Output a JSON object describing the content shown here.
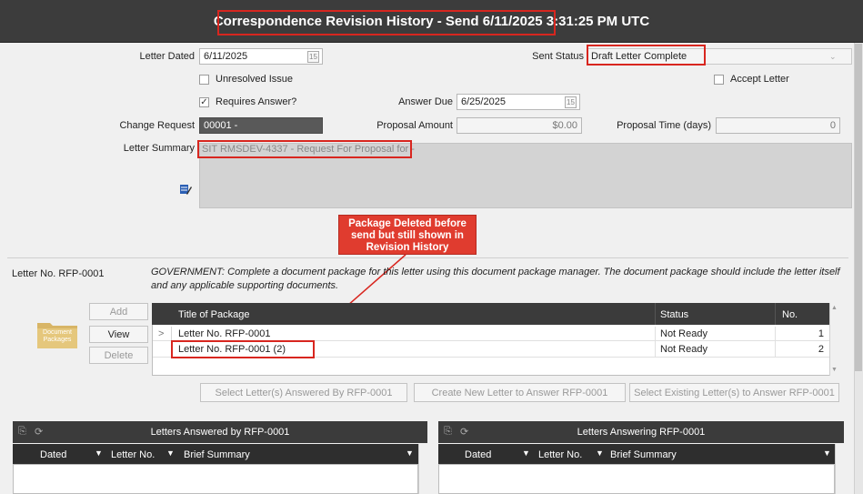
{
  "window": {
    "title": "Correspondence Revision History - Send 6/11/2025 3:31:25 PM UTC"
  },
  "form": {
    "letter_dated_label": "Letter Dated",
    "letter_dated_value": "6/11/2025",
    "sent_status_label": "Sent Status",
    "sent_status_value": "Draft Letter Complete",
    "unresolved_issue_label": "Unresolved Issue",
    "accept_letter_label": "Accept Letter",
    "requires_answer_label": "Requires Answer?",
    "requires_answer_checked": "✓",
    "answer_due_label": "Answer Due",
    "answer_due_value": "6/25/2025",
    "change_request_label": "Change Request",
    "change_request_value": "00001 -",
    "proposal_amount_label": "Proposal Amount",
    "proposal_amount_value": "$0.00",
    "proposal_time_label": "Proposal Time (days)",
    "proposal_time_value": "0",
    "letter_summary_label": "Letter Summary",
    "letter_summary_value": "SIT RMSDEV-4337 - Request For Proposal for -",
    "calendar_glyph": "15"
  },
  "annotation": {
    "callout_text": "Package Deleted before send but still shown in Revision History"
  },
  "packages": {
    "letter_no_label": "Letter No. RFP-0001",
    "instruction": "GOVERNMENT: Complete a document package for this letter using this document package manager. The document package should include the letter itself and any applicable supporting documents.",
    "icon_label": "Document Packages",
    "add_label": "Add",
    "view_label": "View",
    "delete_label": "Delete",
    "columns": [
      "Title of Package",
      "Status",
      "No."
    ],
    "rows": [
      {
        "indicator": ">",
        "title": "Letter No. RFP-0001",
        "status": "Not Ready",
        "no": "1"
      },
      {
        "indicator": "",
        "title": "Letter No. RFP-0001 (2)",
        "status": "Not Ready",
        "no": "2"
      }
    ],
    "select_answered_label": "Select Letter(s) Answered By RFP-0001",
    "create_new_label": "Create New Letter to Answer RFP-0001",
    "select_existing_label": "Select Existing Letter(s) to Answer RFP-0001"
  },
  "answered_by": {
    "title": "Letters Answered by RFP-0001",
    "columns": [
      "Dated",
      "Letter No.",
      "Brief Summary"
    ]
  },
  "answering": {
    "title": "Letters Answering RFP-0001",
    "columns": [
      "Dated",
      "Letter No.",
      "Brief Summary"
    ]
  },
  "colors": {
    "highlight": "#d8261f",
    "callout": "#e03c2f",
    "title_bar": "#3c3c3c"
  }
}
